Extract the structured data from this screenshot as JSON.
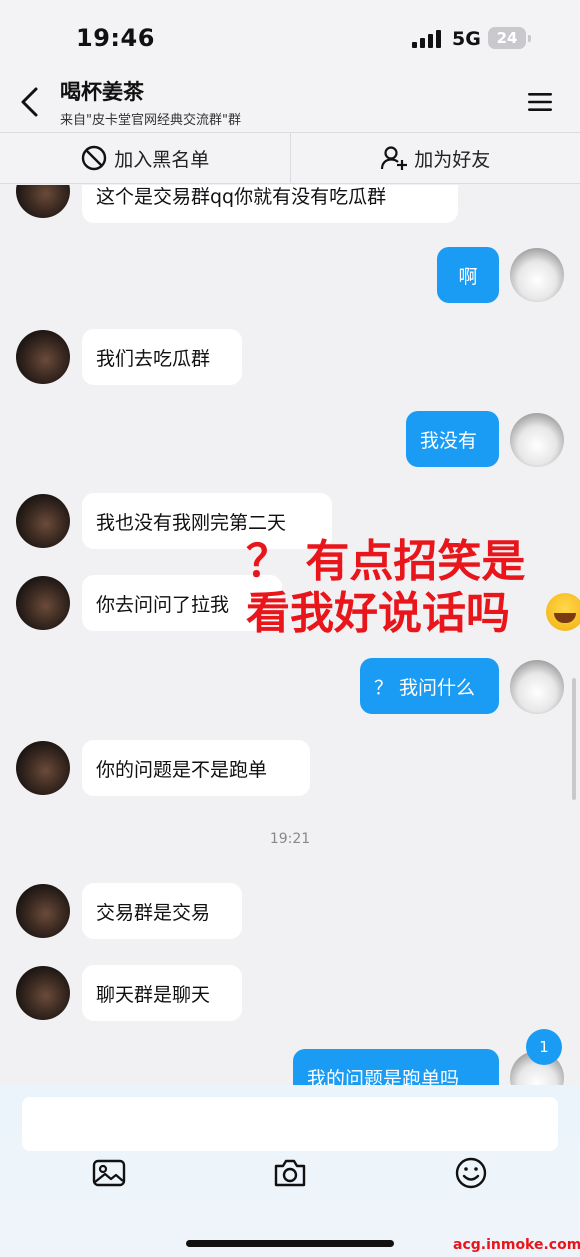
{
  "status": {
    "time": "19:46",
    "network": "5G",
    "battery": "24"
  },
  "header": {
    "title": "喝杯姜茶",
    "subtitle": "来自\"皮卡堂官网经典交流群\"群"
  },
  "actions": {
    "block": "加入黑名单",
    "add_friend": "加为好友"
  },
  "messages": [
    {
      "side": "left",
      "text": "这个是交易群qq你就有没有吃瓜群"
    },
    {
      "side": "right",
      "text": "啊"
    },
    {
      "side": "left",
      "text": "我们去吃瓜群"
    },
    {
      "side": "right",
      "text": "我没有"
    },
    {
      "side": "left",
      "text": "我也没有我刚完第二天"
    },
    {
      "side": "left",
      "text": "你去问问了拉我"
    },
    {
      "side": "right",
      "text": "？ 我问什么"
    },
    {
      "side": "left",
      "text": "你的问题是不是跑单"
    },
    {
      "side": "left",
      "text": "交易群是交易"
    },
    {
      "side": "left",
      "text": "聊天群是聊天"
    },
    {
      "side": "right",
      "text": "我的问题是跑单吗"
    }
  ],
  "timestamp": "19:21",
  "unread_badge": "1",
  "overlay": {
    "line1": "？ 有点招笑是",
    "line2": "看我好说话吗"
  },
  "watermark": "acg.inmoke.com",
  "toolbar_icons": [
    "image-icon",
    "camera-icon",
    "emoji-icon"
  ]
}
